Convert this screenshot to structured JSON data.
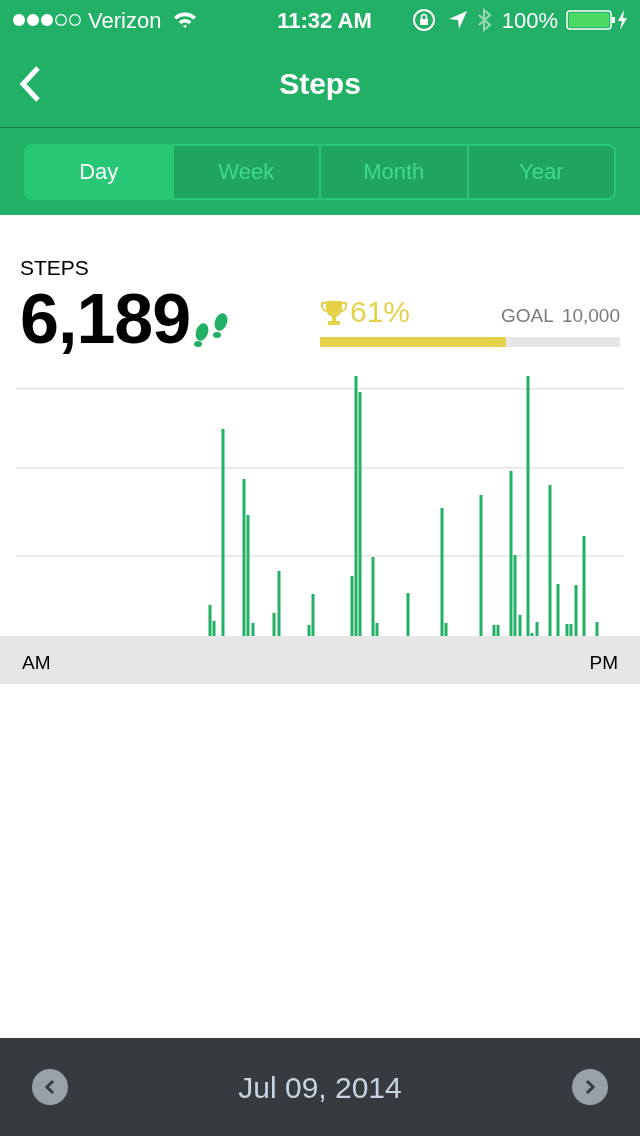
{
  "status_bar": {
    "carrier": "Verizon",
    "time": "11:32 AM",
    "battery": "100%"
  },
  "nav": {
    "title": "Steps"
  },
  "tabs": [
    {
      "label": "Day",
      "selected": true
    },
    {
      "label": "Week",
      "selected": false
    },
    {
      "label": "Month",
      "selected": false
    },
    {
      "label": "Year",
      "selected": false
    }
  ],
  "summary": {
    "label": "STEPS",
    "count": "6,189",
    "percent": "61%",
    "goal_label": "GOAL",
    "goal_value": "10,000",
    "level": 0.62
  },
  "chart": {
    "start_label": "AM",
    "end_label": "PM"
  },
  "footer": {
    "date": "Jul 09, 2014"
  }
}
